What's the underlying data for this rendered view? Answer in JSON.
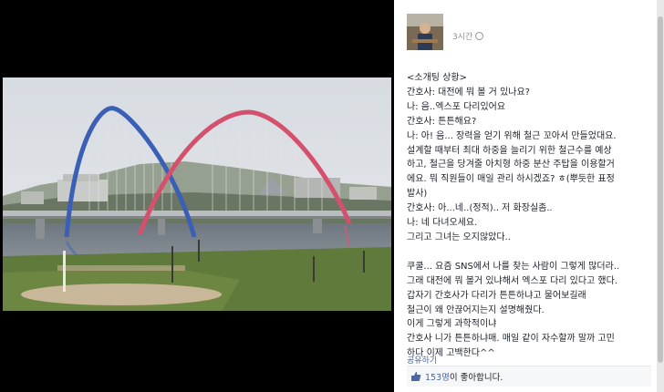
{
  "post": {
    "time": "3시간",
    "lines": [
      "<소개팅 상황>",
      "간호사: 대전에 뭐 볼 거 있나요?",
      "나: 음..엑스포 다리있어요",
      "간호사: 튼튼해요?",
      "나: 아! 음... 장력을 얻기 위해 철근 꼬아서 만들었대요.",
      "설계할 때부터 최대 하중을 늘리기 위한 철근수를 예상",
      "하고, 철근을 당겨줄 아치형 하중 분산 주탑을 이용할거",
      "에요. 뭐 직원들이 매일 관리 하시겠죠? ㅎ(뿌듯한 표정",
      "발사)",
      "간호사: 아...네..(정적).. 저 화장실좀..",
      "나: 네 다녀오세요.",
      "그리고 그녀는 오지않았다..",
      "",
      "쿠쿨... 요즘 SNS에서 나를 찾는 사람이 그렇게 많더라..",
      "그래 대전에 뭐 볼거 있냐해서 엑스포 다리 있다고 했다.",
      "갑자기 간호사가 다리가 튼튼하냐고 물어보길래",
      "철근이 왜 안끊어지는지 설명해줬다.",
      "이게 그렇게 과학적이냐",
      "간호사 니가 튼튼하냐매. 매일 같이 자수할까 말까 고민",
      "하다 이제 고백한다^^"
    ]
  },
  "actions": {
    "share": "공유하기"
  },
  "likes": {
    "count": "153명",
    "suffix": "이 좋아합니다."
  }
}
